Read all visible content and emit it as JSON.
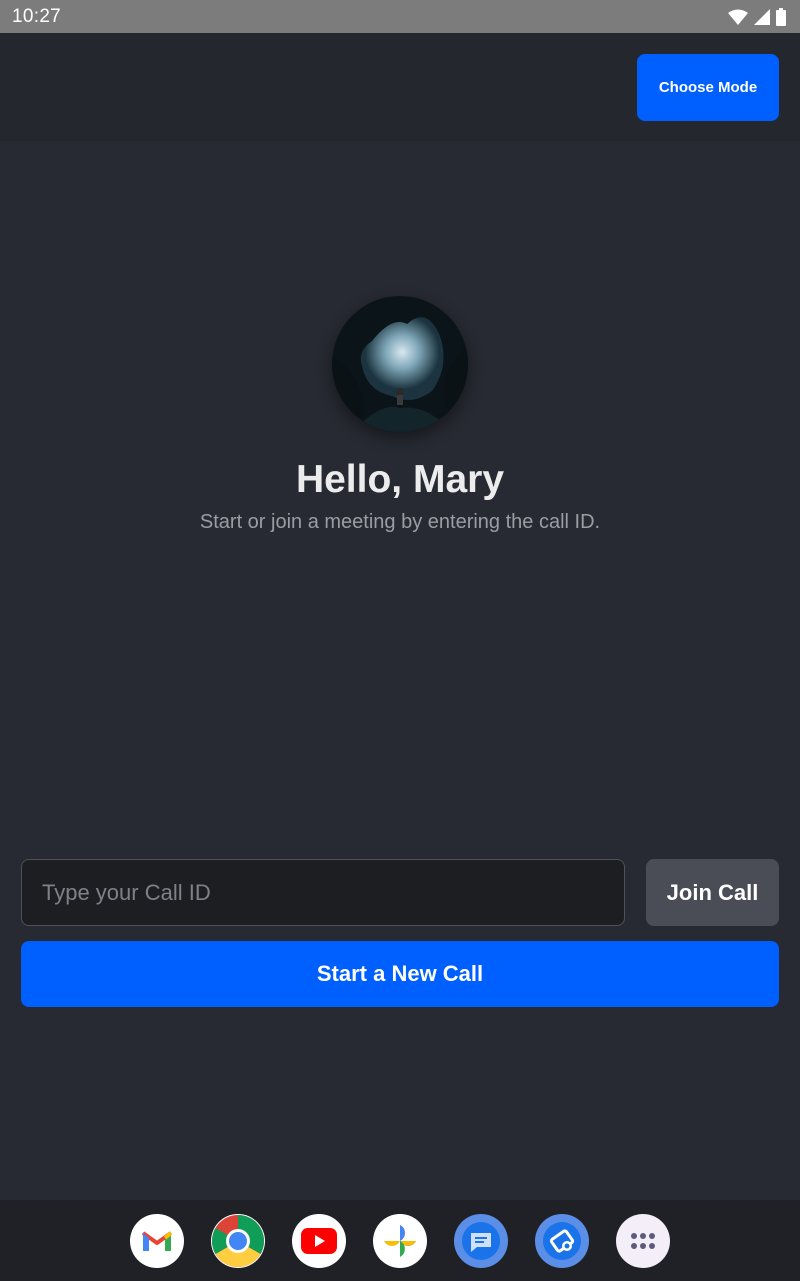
{
  "status_bar": {
    "time": "10:27",
    "icons": [
      "wifi-icon",
      "signal-icon",
      "battery-icon"
    ]
  },
  "header": {
    "choose_mode_label": "Choose Mode"
  },
  "profile": {
    "greeting": "Hello, Mary",
    "subtitle": "Start or join a meeting by entering the call ID."
  },
  "call": {
    "input_placeholder": "Type your Call ID",
    "input_value": "",
    "join_label": "Join Call",
    "start_label": "Start a New Call"
  },
  "dock": {
    "apps": [
      "gmail-icon",
      "chrome-icon",
      "youtube-icon",
      "photos-icon",
      "messages-icon",
      "screen-rotate-icon",
      "app-drawer-icon"
    ]
  },
  "colors": {
    "background": "#272a32",
    "accent": "#005fff",
    "secondary_button": "#4a4d55",
    "status_bar": "#7c7c7c"
  }
}
